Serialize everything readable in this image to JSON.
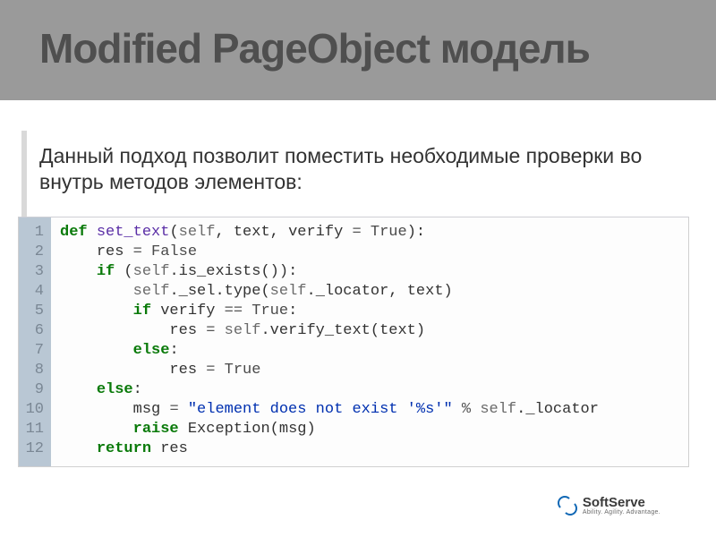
{
  "title": "Modified PageObject модель",
  "body": "Данный подход позволит поместить необходимые проверки во внутрь методов элементов:",
  "logo": {
    "brand": "SoftServe",
    "tagline": "Ability. Agility. Advantage."
  },
  "code": {
    "line_count": 12,
    "tokens": {
      "def": "def",
      "fn_name": "set_text",
      "self": "self",
      "param_text": "text",
      "param_verify": "verify",
      "True": "True",
      "False": "False",
      "res": "res",
      "if": "if",
      "is_exists": "is_exists",
      "sel": "_sel",
      "type": "type",
      "locator": "_locator",
      "eqeq": "==",
      "verify_text": "verify_text",
      "else": "else",
      "msg": "msg",
      "str_lit": "\"element does not exist '%s'\"",
      "pct": "%",
      "raise": "raise",
      "Exception": "Exception",
      "return": "return"
    }
  }
}
